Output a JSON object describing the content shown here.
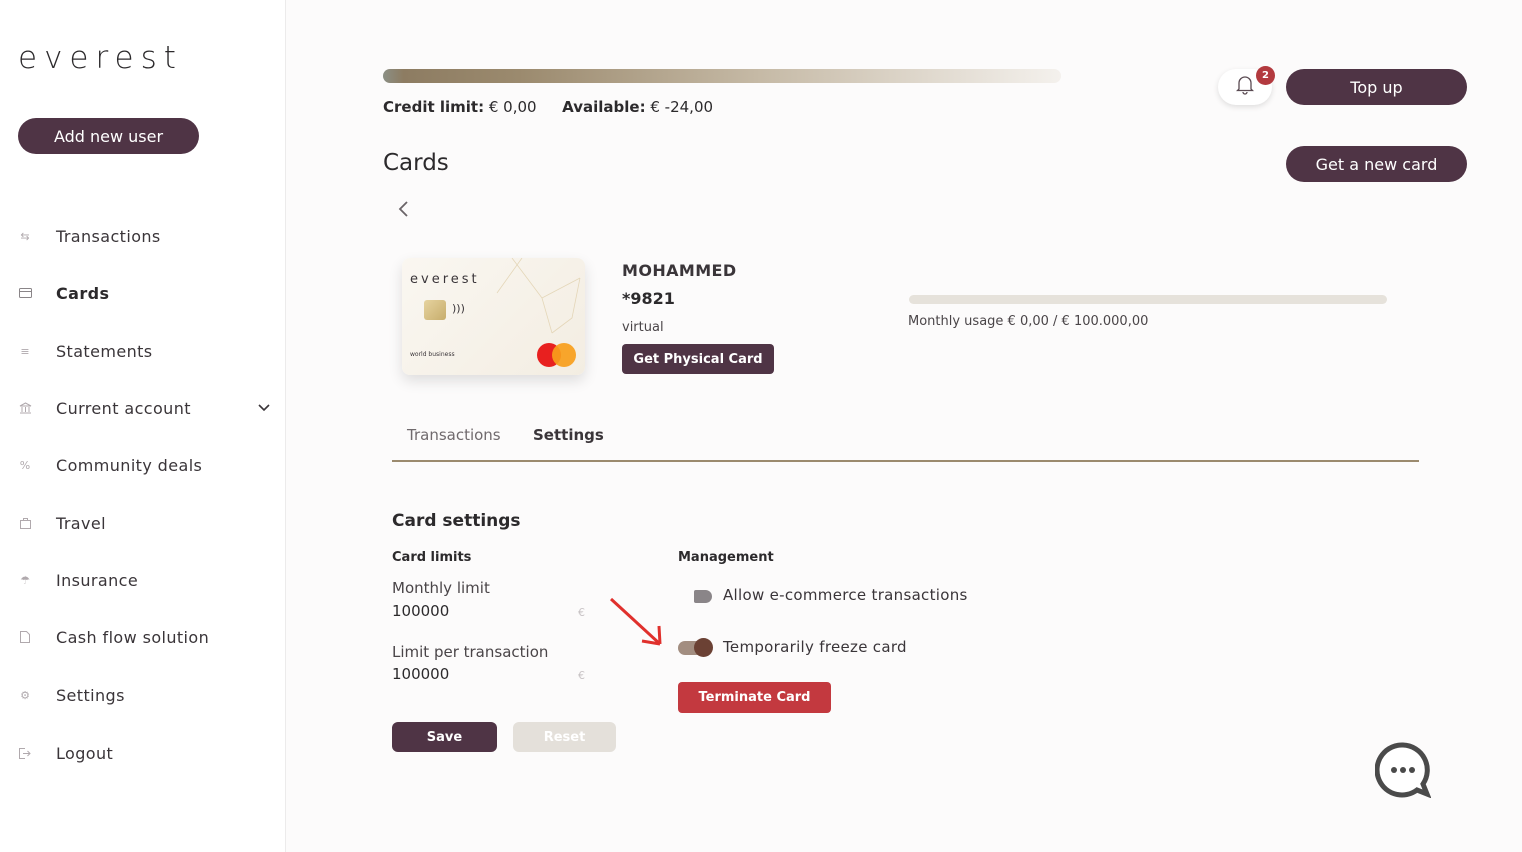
{
  "brand": {
    "logo": "everest"
  },
  "sidebar": {
    "add_user_label": "Add new user",
    "items": [
      {
        "label": "Transactions",
        "icon": "transfer-icon"
      },
      {
        "label": "Cards",
        "icon": "card-icon",
        "active": true
      },
      {
        "label": "Statements",
        "icon": "statements-icon"
      },
      {
        "label": "Current account",
        "icon": "bank-icon",
        "has_chevron": true
      },
      {
        "label": "Community deals",
        "icon": "percent-icon"
      },
      {
        "label": "Travel",
        "icon": "bag-icon"
      },
      {
        "label": "Insurance",
        "icon": "umbrella-icon"
      },
      {
        "label": "Cash flow solution",
        "icon": "document-icon"
      },
      {
        "label": "Settings",
        "icon": "gear-icon"
      },
      {
        "label": "Logout",
        "icon": "logout-icon"
      }
    ]
  },
  "header": {
    "credit_label": "Credit limit:",
    "credit_value": "€ 0,00",
    "available_label": "Available:",
    "available_value": "€ -24,00",
    "notification_count": "2",
    "topup_label": "Top up",
    "new_card_label": "Get a new card"
  },
  "page": {
    "title": "Cards"
  },
  "card": {
    "brand": "everest",
    "card_line": "world business",
    "holder": "MOHAMMED",
    "number": "*9821",
    "type": "virtual",
    "physical_button": "Get Physical Card",
    "usage_text": "Monthly usage € 0,00 / € 100.000,00",
    "usage_fraction": 0
  },
  "tabs": [
    {
      "label": "Transactions"
    },
    {
      "label": "Settings",
      "active": true
    }
  ],
  "settings": {
    "title": "Card settings",
    "limits_heading": "Card limits",
    "monthly_label": "Monthly limit",
    "monthly_value": "100000",
    "per_tx_label": "Limit per transaction",
    "per_tx_value": "100000",
    "currency_symbol": "€",
    "management_heading": "Management",
    "ecommerce_label": "Allow e-commerce transactions",
    "ecommerce_on": false,
    "freeze_label": "Temporarily freeze card",
    "freeze_on": true,
    "terminate_label": "Terminate Card",
    "save_label": "Save",
    "reset_label": "Reset"
  },
  "colors": {
    "primary": "#4f3445",
    "danger": "#c3393f",
    "accent": "#9b8a6e",
    "annotation_arrow": "#e0302c"
  }
}
